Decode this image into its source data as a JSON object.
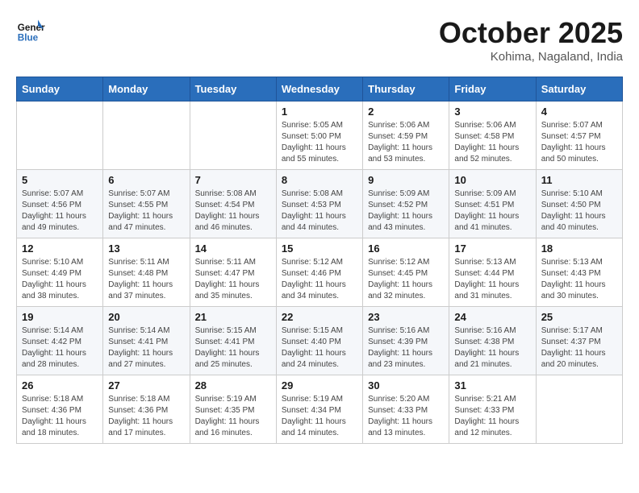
{
  "header": {
    "logo_line1": "General",
    "logo_line2": "Blue",
    "month": "October 2025",
    "location": "Kohima, Nagaland, India"
  },
  "weekdays": [
    "Sunday",
    "Monday",
    "Tuesday",
    "Wednesday",
    "Thursday",
    "Friday",
    "Saturday"
  ],
  "weeks": [
    [
      {
        "day": "",
        "sunrise": "",
        "sunset": "",
        "daylight": ""
      },
      {
        "day": "",
        "sunrise": "",
        "sunset": "",
        "daylight": ""
      },
      {
        "day": "",
        "sunrise": "",
        "sunset": "",
        "daylight": ""
      },
      {
        "day": "1",
        "sunrise": "Sunrise: 5:05 AM",
        "sunset": "Sunset: 5:00 PM",
        "daylight": "Daylight: 11 hours and 55 minutes."
      },
      {
        "day": "2",
        "sunrise": "Sunrise: 5:06 AM",
        "sunset": "Sunset: 4:59 PM",
        "daylight": "Daylight: 11 hours and 53 minutes."
      },
      {
        "day": "3",
        "sunrise": "Sunrise: 5:06 AM",
        "sunset": "Sunset: 4:58 PM",
        "daylight": "Daylight: 11 hours and 52 minutes."
      },
      {
        "day": "4",
        "sunrise": "Sunrise: 5:07 AM",
        "sunset": "Sunset: 4:57 PM",
        "daylight": "Daylight: 11 hours and 50 minutes."
      }
    ],
    [
      {
        "day": "5",
        "sunrise": "Sunrise: 5:07 AM",
        "sunset": "Sunset: 4:56 PM",
        "daylight": "Daylight: 11 hours and 49 minutes."
      },
      {
        "day": "6",
        "sunrise": "Sunrise: 5:07 AM",
        "sunset": "Sunset: 4:55 PM",
        "daylight": "Daylight: 11 hours and 47 minutes."
      },
      {
        "day": "7",
        "sunrise": "Sunrise: 5:08 AM",
        "sunset": "Sunset: 4:54 PM",
        "daylight": "Daylight: 11 hours and 46 minutes."
      },
      {
        "day": "8",
        "sunrise": "Sunrise: 5:08 AM",
        "sunset": "Sunset: 4:53 PM",
        "daylight": "Daylight: 11 hours and 44 minutes."
      },
      {
        "day": "9",
        "sunrise": "Sunrise: 5:09 AM",
        "sunset": "Sunset: 4:52 PM",
        "daylight": "Daylight: 11 hours and 43 minutes."
      },
      {
        "day": "10",
        "sunrise": "Sunrise: 5:09 AM",
        "sunset": "Sunset: 4:51 PM",
        "daylight": "Daylight: 11 hours and 41 minutes."
      },
      {
        "day": "11",
        "sunrise": "Sunrise: 5:10 AM",
        "sunset": "Sunset: 4:50 PM",
        "daylight": "Daylight: 11 hours and 40 minutes."
      }
    ],
    [
      {
        "day": "12",
        "sunrise": "Sunrise: 5:10 AM",
        "sunset": "Sunset: 4:49 PM",
        "daylight": "Daylight: 11 hours and 38 minutes."
      },
      {
        "day": "13",
        "sunrise": "Sunrise: 5:11 AM",
        "sunset": "Sunset: 4:48 PM",
        "daylight": "Daylight: 11 hours and 37 minutes."
      },
      {
        "day": "14",
        "sunrise": "Sunrise: 5:11 AM",
        "sunset": "Sunset: 4:47 PM",
        "daylight": "Daylight: 11 hours and 35 minutes."
      },
      {
        "day": "15",
        "sunrise": "Sunrise: 5:12 AM",
        "sunset": "Sunset: 4:46 PM",
        "daylight": "Daylight: 11 hours and 34 minutes."
      },
      {
        "day": "16",
        "sunrise": "Sunrise: 5:12 AM",
        "sunset": "Sunset: 4:45 PM",
        "daylight": "Daylight: 11 hours and 32 minutes."
      },
      {
        "day": "17",
        "sunrise": "Sunrise: 5:13 AM",
        "sunset": "Sunset: 4:44 PM",
        "daylight": "Daylight: 11 hours and 31 minutes."
      },
      {
        "day": "18",
        "sunrise": "Sunrise: 5:13 AM",
        "sunset": "Sunset: 4:43 PM",
        "daylight": "Daylight: 11 hours and 30 minutes."
      }
    ],
    [
      {
        "day": "19",
        "sunrise": "Sunrise: 5:14 AM",
        "sunset": "Sunset: 4:42 PM",
        "daylight": "Daylight: 11 hours and 28 minutes."
      },
      {
        "day": "20",
        "sunrise": "Sunrise: 5:14 AM",
        "sunset": "Sunset: 4:41 PM",
        "daylight": "Daylight: 11 hours and 27 minutes."
      },
      {
        "day": "21",
        "sunrise": "Sunrise: 5:15 AM",
        "sunset": "Sunset: 4:41 PM",
        "daylight": "Daylight: 11 hours and 25 minutes."
      },
      {
        "day": "22",
        "sunrise": "Sunrise: 5:15 AM",
        "sunset": "Sunset: 4:40 PM",
        "daylight": "Daylight: 11 hours and 24 minutes."
      },
      {
        "day": "23",
        "sunrise": "Sunrise: 5:16 AM",
        "sunset": "Sunset: 4:39 PM",
        "daylight": "Daylight: 11 hours and 23 minutes."
      },
      {
        "day": "24",
        "sunrise": "Sunrise: 5:16 AM",
        "sunset": "Sunset: 4:38 PM",
        "daylight": "Daylight: 11 hours and 21 minutes."
      },
      {
        "day": "25",
        "sunrise": "Sunrise: 5:17 AM",
        "sunset": "Sunset: 4:37 PM",
        "daylight": "Daylight: 11 hours and 20 minutes."
      }
    ],
    [
      {
        "day": "26",
        "sunrise": "Sunrise: 5:18 AM",
        "sunset": "Sunset: 4:36 PM",
        "daylight": "Daylight: 11 hours and 18 minutes."
      },
      {
        "day": "27",
        "sunrise": "Sunrise: 5:18 AM",
        "sunset": "Sunset: 4:36 PM",
        "daylight": "Daylight: 11 hours and 17 minutes."
      },
      {
        "day": "28",
        "sunrise": "Sunrise: 5:19 AM",
        "sunset": "Sunset: 4:35 PM",
        "daylight": "Daylight: 11 hours and 16 minutes."
      },
      {
        "day": "29",
        "sunrise": "Sunrise: 5:19 AM",
        "sunset": "Sunset: 4:34 PM",
        "daylight": "Daylight: 11 hours and 14 minutes."
      },
      {
        "day": "30",
        "sunrise": "Sunrise: 5:20 AM",
        "sunset": "Sunset: 4:33 PM",
        "daylight": "Daylight: 11 hours and 13 minutes."
      },
      {
        "day": "31",
        "sunrise": "Sunrise: 5:21 AM",
        "sunset": "Sunset: 4:33 PM",
        "daylight": "Daylight: 11 hours and 12 minutes."
      },
      {
        "day": "",
        "sunrise": "",
        "sunset": "",
        "daylight": ""
      }
    ]
  ]
}
